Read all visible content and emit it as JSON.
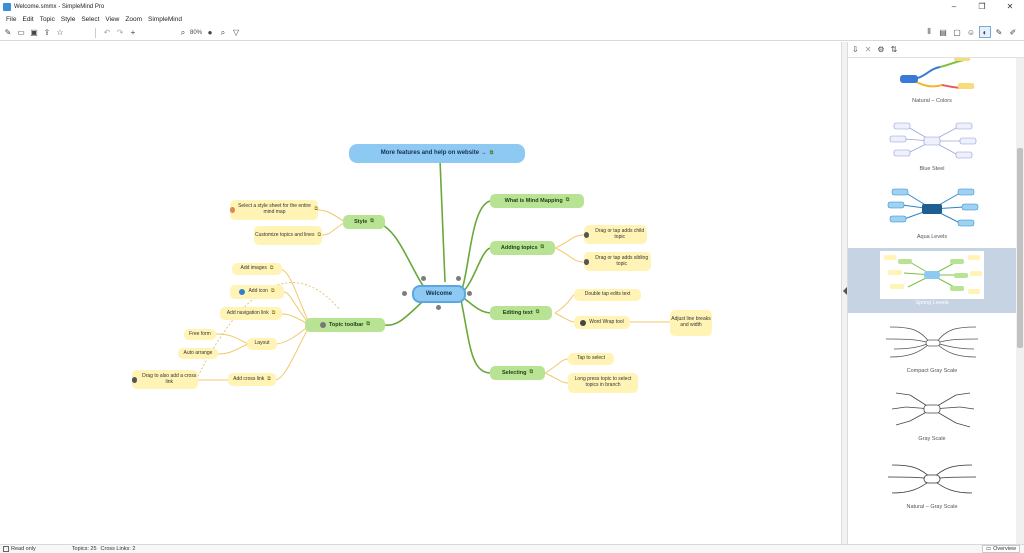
{
  "window": {
    "title": "Welcome.smmx - SimpleMind Pro",
    "controls": [
      "–",
      "❐",
      "✕"
    ]
  },
  "menu": [
    "File",
    "Edit",
    "Topic",
    "Style",
    "Select",
    "View",
    "Zoom",
    "SimpleMind"
  ],
  "toolbar": {
    "zoom": "80%"
  },
  "map": {
    "center": "Welcome",
    "website": "More features and help on website →",
    "style": "Style",
    "style_children": [
      "Select a style sheet for the entire mind map",
      "Customize topics and lines"
    ],
    "topic_toolbar": "Topic toolbar",
    "toolbar_children": [
      "Add images",
      "Add icon",
      "Add navigation link",
      "Layout",
      "Add cross link"
    ],
    "layout_children": [
      "Free form",
      "Auto arrange"
    ],
    "cross_link_child": "Drag to also add a cross link",
    "what_is": "What is Mind Mapping",
    "adding_topics": "Adding topics",
    "adding_children": [
      "Drag or tap adds child topic",
      "Drag or tap adds sibling topic"
    ],
    "editing_text": "Editing text",
    "editing_children": [
      "Double tap edits text",
      "Word Wrap tool"
    ],
    "word_wrap_child": "Adjust line breaks and width",
    "selecting": "Selecting",
    "selecting_children": [
      "Tap to select",
      "Long press topic to select topics in branch"
    ]
  },
  "styles": [
    {
      "name": "Natural – Colors",
      "accent": "#3a7ad6"
    },
    {
      "name": "Blue Steel",
      "accent": "#8a9ad8"
    },
    {
      "name": "Aqua Levels",
      "accent": "#2a85c8"
    },
    {
      "name": "Spring Levels",
      "accent": "#7cc144",
      "selected": true
    },
    {
      "name": "Compact Gray Scale",
      "accent": "#555555"
    },
    {
      "name": "Gray Scale",
      "accent": "#444444"
    },
    {
      "name": "Natural – Gray Scale",
      "accent": "#333333"
    }
  ],
  "status": {
    "readonly": "Read only",
    "topics": "Topics: 25",
    "cross_links": "Cross Links: 2",
    "overview": "Overview"
  }
}
